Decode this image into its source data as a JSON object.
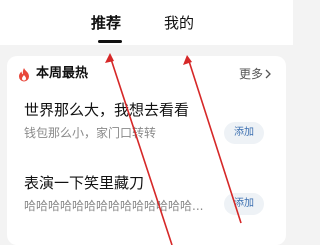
{
  "tabs": [
    {
      "label": "推荐",
      "active": true
    },
    {
      "label": "我的",
      "active": false
    }
  ],
  "card": {
    "title": "本周最热",
    "more_label": "更多",
    "icon": "flame-icon",
    "items": [
      {
        "title": "世界那么大，我想去看看",
        "subtitle": "钱包那么小，家门口转转",
        "button": "添加"
      },
      {
        "title": "表演一下笑里藏刀",
        "subtitle": "哈哈哈哈哈哈哈哈哈哈哈哈哈哈...",
        "button": "添加"
      }
    ]
  },
  "colors": {
    "accent_red": "#e8473b",
    "annotation_red": "#d62828",
    "add_button_text": "#3b6fb0",
    "page_background": "#f3f3f3"
  }
}
